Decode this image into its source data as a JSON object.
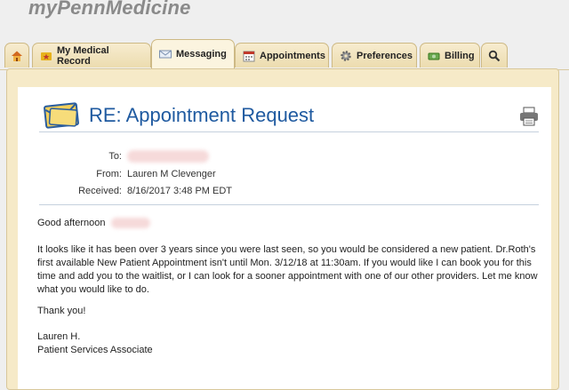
{
  "app": {
    "brand": "myPennMedicine"
  },
  "tabs": [
    {
      "label": "",
      "icon": "home-icon"
    },
    {
      "label": "My Medical Record",
      "icon": "star-folder-icon"
    },
    {
      "label": "Messaging",
      "icon": "envelope-icon"
    },
    {
      "label": "Appointments",
      "icon": "calendar-icon"
    },
    {
      "label": "Preferences",
      "icon": "gear-icon"
    },
    {
      "label": "Billing",
      "icon": "money-icon"
    },
    {
      "label": "",
      "icon": "search-icon"
    }
  ],
  "active_tab": "Messaging",
  "message": {
    "title": "RE: Appointment Request",
    "to_label": "To:",
    "from_label": "From:",
    "from_value": "Lauren M Clevenger",
    "received_label": "Received:",
    "received_value": "8/16/2017  3:48 PM EDT",
    "greeting": "Good afternoon",
    "body": "It looks like it has been over 3 years since you were last seen, so you would be considered a new patient. Dr.Roth's first available New Patient Appointment isn't until Mon. 3/12/18 at 11:30am. If you would like I can book you for this time and add you to the waitlist, or I can look for a sooner appointment with one of our other providers. Let me know what you would like to do.",
    "thanks": "Thank you!",
    "signature_name": "Lauren H.",
    "signature_title": "Patient Services Associate"
  },
  "colors": {
    "accent": "#1f5aa0",
    "tab_bg": "#f2e4bd",
    "panel_bg": "#f6eac8"
  }
}
